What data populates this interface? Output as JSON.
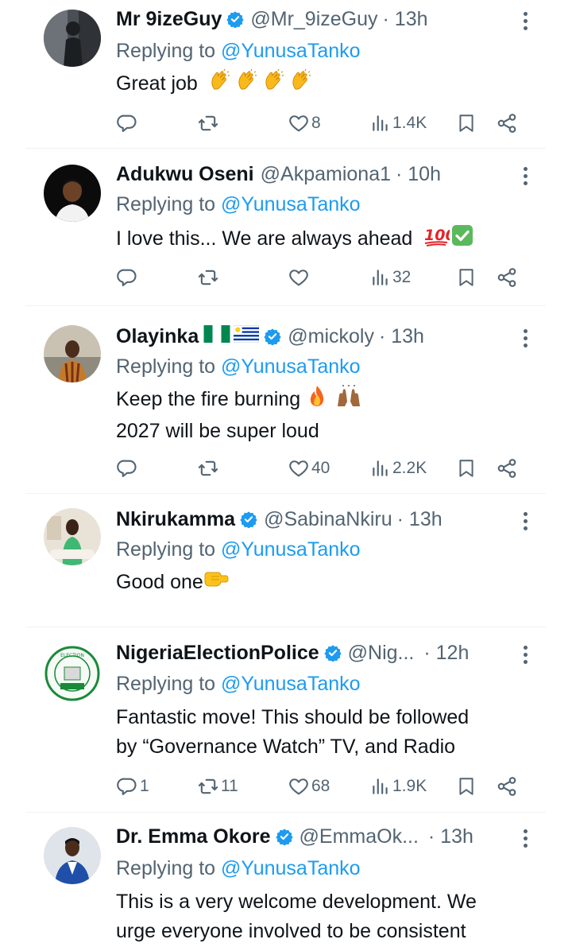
{
  "replies": [
    {
      "name": "Mr 9izeGuy",
      "verified": true,
      "handle": "@Mr_9izeGuy",
      "time": "· 13h",
      "replying_prefix": "Replying to ",
      "replying_to": "@YunusaTanko",
      "text_lines": [
        "Great job"
      ],
      "emoji": [
        "clapping-hands",
        "clapping-hands",
        "clapping-hands",
        "clapping-hands"
      ],
      "counts": {
        "replies": "",
        "reposts": "",
        "likes": "8",
        "views": "1.4K"
      }
    },
    {
      "name": "Adukwu Oseni",
      "verified": false,
      "handle": "@Akpamiona1",
      "time": "· 10h",
      "replying_prefix": "Replying to ",
      "replying_to": "@YunusaTanko",
      "text_lines": [
        "I love this... We are always ahead"
      ],
      "emoji": [
        "hundred-points",
        "check-mark-button"
      ],
      "counts": {
        "replies": "",
        "reposts": "",
        "likes": "",
        "views": "32"
      }
    },
    {
      "name": "Olayinka",
      "verified": true,
      "name_flags": [
        "nigeria-flag",
        "uruguay-flag"
      ],
      "handle": "@mickoly",
      "time": "· 13h",
      "replying_prefix": "Replying to ",
      "replying_to": "@YunusaTanko",
      "text_lines": [
        "Keep the fire burning",
        "2027 will be super loud"
      ],
      "emoji": [
        "fire",
        "raising-hands"
      ],
      "counts": {
        "replies": "",
        "reposts": "",
        "likes": "40",
        "views": "2.2K"
      }
    },
    {
      "name": "Nkirukamma",
      "verified": true,
      "handle": "@SabinaNkiru",
      "time": "· 13h",
      "replying_prefix": "Replying to ",
      "replying_to": "@YunusaTanko",
      "text_lines": [
        "Good one"
      ],
      "emoji": [
        "right-facing-fist"
      ],
      "counts": null
    },
    {
      "name": "NigeriaElectionPolice",
      "verified": true,
      "handle": "@Nig...",
      "time": "· 12h",
      "replying_prefix": "Replying to ",
      "replying_to": "@YunusaTanko",
      "text_lines": [
        "Fantastic move! This should be followed",
        "by “Governance Watch” TV, and Radio"
      ],
      "emoji": [],
      "counts": {
        "replies": "1",
        "reposts": "11",
        "likes": "68",
        "views": "1.9K"
      }
    },
    {
      "name": "Dr. Emma Okore",
      "verified": true,
      "handle": "@EmmaOk...",
      "time": "· 13h",
      "replying_prefix": "Replying to ",
      "replying_to": "@YunusaTanko",
      "text_lines": [
        "This is a very welcome development. We",
        "urge everyone involved to be consistent"
      ],
      "emoji": [],
      "counts": null
    }
  ],
  "colors": {
    "text": "#0f1419",
    "muted": "#536471",
    "link": "#1d9bf0",
    "verified": "#1d9bf0",
    "divider": "#eff3f4"
  },
  "icons": [
    "reply-icon",
    "repost-icon",
    "like-icon",
    "views-icon",
    "bookmark-icon",
    "share-icon",
    "more-icon",
    "verified-badge-icon"
  ]
}
